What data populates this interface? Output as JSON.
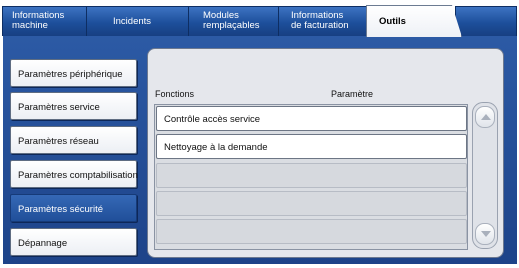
{
  "tabs": [
    {
      "label_line1": "Informations",
      "label_line2": "machine"
    },
    {
      "label_line1": "Incidents",
      "label_line2": ""
    },
    {
      "label_line1": "Modules",
      "label_line2": "remplaçables"
    },
    {
      "label_line1": "Informations",
      "label_line2": "de facturation"
    },
    {
      "label_line1": "Outils",
      "label_line2": ""
    }
  ],
  "active_tab": "Outils",
  "menu": {
    "items": [
      {
        "label": "Paramètres périphérique"
      },
      {
        "label": "Paramètres service"
      },
      {
        "label": "Paramètres réseau"
      },
      {
        "label": "Paramètres comptabilisation"
      },
      {
        "label": "Paramètres sécurité"
      },
      {
        "label": "Dépannage"
      }
    ],
    "selected": "Paramètres sécurité"
  },
  "table": {
    "headers": {
      "functions": "Fonctions",
      "setting": "Paramètre"
    },
    "rows": [
      {
        "function": "Contrôle accès service",
        "setting": ""
      },
      {
        "function": "Nettoyage à la demande",
        "setting": ""
      },
      {
        "function": "",
        "setting": ""
      },
      {
        "function": "",
        "setting": ""
      },
      {
        "function": "",
        "setting": ""
      }
    ]
  },
  "icons": {
    "scroll_up": "chevron-up-icon",
    "scroll_down": "chevron-down-icon"
  },
  "colors": {
    "tab_blue": "#1d4f9b",
    "selected_blue": "#2a5ca8",
    "background_blue": "#24498f"
  }
}
